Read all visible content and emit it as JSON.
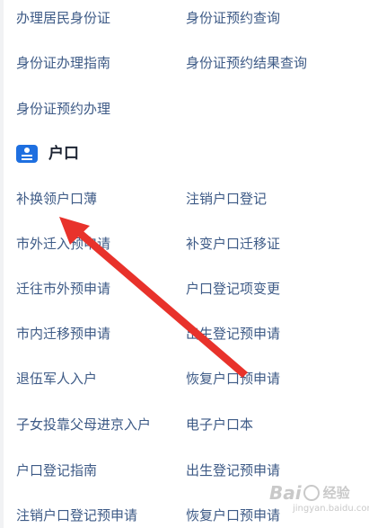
{
  "rows": [
    {
      "left": "办理居民身份证",
      "right": "身份证预约查询"
    },
    {
      "left": "身份证办理指南",
      "right": "身份证预约结果查询"
    },
    {
      "left": "身份证预约办理",
      "right": ""
    }
  ],
  "section": {
    "icon": "id-card-icon",
    "title": "户口",
    "accent": "#1e6fe0"
  },
  "hukou_rows": [
    {
      "left": "补换领户口薄",
      "right": "注销户口登记"
    },
    {
      "left": "市外迁入预申请",
      "right": "补变户口迁移证"
    },
    {
      "left": "迁往市外预申请",
      "right": "户口登记项变更"
    },
    {
      "left": "市内迁移预申请",
      "right": "出生登记预申请"
    },
    {
      "left": "退伍军人入户",
      "right": "恢复户口预申请"
    },
    {
      "left": "子女投靠父母进京入户",
      "right": "电子户口本"
    },
    {
      "left": "户口登记指南",
      "right": "出生登记预申请"
    },
    {
      "left": "注销户口登记预申请",
      "right": "恢复户口预申请"
    }
  ],
  "colors": {
    "link": "#3d5a86",
    "title": "#1d2433",
    "arrow": "#e8322b"
  },
  "watermark": {
    "brand_left": "Bai",
    "brand_right": "经验",
    "url": "jingyan.baidu.com"
  }
}
